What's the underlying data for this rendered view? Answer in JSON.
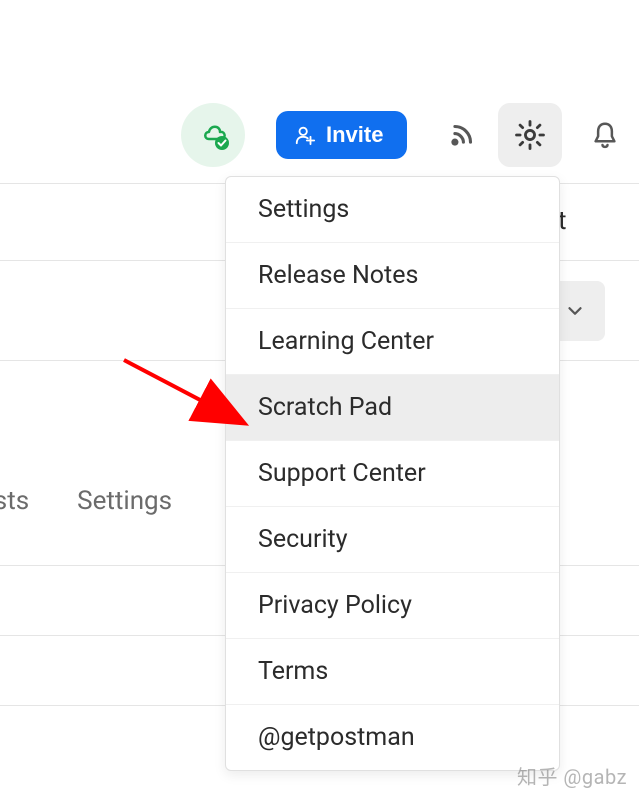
{
  "topbar": {
    "invite_label": "Invite"
  },
  "menu": {
    "items": [
      {
        "label": "Settings",
        "highlighted": false
      },
      {
        "label": "Release Notes",
        "highlighted": false
      },
      {
        "label": "Learning Center",
        "highlighted": false
      },
      {
        "label": "Scratch Pad",
        "highlighted": true
      },
      {
        "label": "Support Center",
        "highlighted": false
      },
      {
        "label": "Security",
        "highlighted": false
      },
      {
        "label": "Privacy Policy",
        "highlighted": false
      },
      {
        "label": "Terms",
        "highlighted": false
      },
      {
        "label": "@getpostman",
        "highlighted": false
      }
    ]
  },
  "tabs": {
    "tests_partial": "ests",
    "settings": "Settings"
  },
  "behind_char": "t",
  "watermark": "知乎 @gabz",
  "colors": {
    "invite_bg": "#106fef",
    "cloud_bg": "#e6f5eb",
    "cloud_badge": "#1ba84f",
    "gear_active_bg": "#eeeeee",
    "highlight_bg": "#ededed",
    "arrow": "#ff0000"
  }
}
